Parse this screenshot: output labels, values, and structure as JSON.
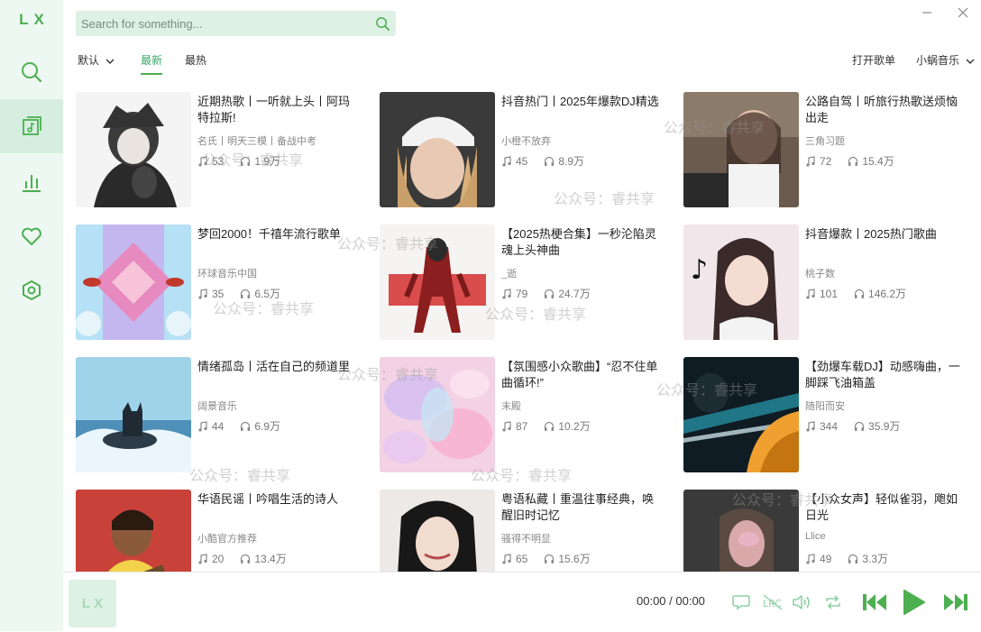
{
  "app": {
    "logo": "LX"
  },
  "sidebar": {
    "items": [
      {
        "icon": "search-icon"
      },
      {
        "icon": "songlist-icon",
        "active": true
      },
      {
        "icon": "leaderboard-icon"
      },
      {
        "icon": "heart-icon"
      },
      {
        "icon": "settings-icon"
      }
    ]
  },
  "search": {
    "placeholder": "Search for something..."
  },
  "tabs": {
    "sort": "默认",
    "latest": "最新",
    "hot": "最热"
  },
  "toolbar": {
    "open_songlist": "打开歌单",
    "source": "小蜗音乐"
  },
  "watermark": "公众号：睿共享",
  "playlists": [
    {
      "name": "近期热歌丨一听就上头丨阿玛特拉斯!",
      "author": "名氏丨明天三模丨备战中考",
      "songs": "53",
      "plays": "1.9万"
    },
    {
      "name": "抖音热门丨2025年爆款DJ精选",
      "author": "小橙不放弃",
      "songs": "45",
      "plays": "8.9万"
    },
    {
      "name": "公路自驾丨听旅行热歌送烦恼出走",
      "author": "三角习题",
      "songs": "72",
      "plays": "15.4万"
    },
    {
      "name": "梦回2000！千禧年流行歌单",
      "author": "环球音乐中国",
      "songs": "35",
      "plays": "6.5万"
    },
    {
      "name": "【2025热梗合集】一秒沦陷灵魂上头神曲",
      "author": "_逝",
      "songs": "79",
      "plays": "24.7万"
    },
    {
      "name": "抖音爆款丨2025热门歌曲",
      "author": "桃子数",
      "songs": "101",
      "plays": "146.2万"
    },
    {
      "name": "情绪孤岛丨活在自己的频道里",
      "author": "阔景音乐",
      "songs": "44",
      "plays": "6.9万"
    },
    {
      "name": "【氛围感小众歌曲】“忍不住单曲循环!”",
      "author": "末殿",
      "songs": "87",
      "plays": "10.2万"
    },
    {
      "name": "【劲爆车载DJ】动感嗨曲，一脚踩飞油箱盖",
      "author": "随阳而安",
      "songs": "344",
      "plays": "35.9万"
    },
    {
      "name": "华语民谣丨吟唱生活的诗人",
      "author": "小酷官方推荐",
      "songs": "20",
      "plays": "13.4万"
    },
    {
      "name": "粤语私藏丨重温往事经典，唤醒旧时记忆",
      "author": "骚得不明显",
      "songs": "65",
      "plays": "15.6万"
    },
    {
      "name": "【小众女声】轻似雀羽，飑如日光",
      "author": "Llice",
      "songs": "49",
      "plays": "3.3万"
    }
  ],
  "player": {
    "cover_text": "LX",
    "time": "00:00 / 00:00"
  },
  "colors": {
    "accent": "#4caf50",
    "sidebar_bg": "#eef8f2",
    "search_bg": "#ddf1e4"
  }
}
